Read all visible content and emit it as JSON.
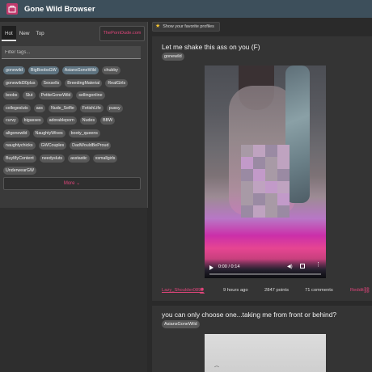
{
  "app": {
    "title": "Gone Wild Browser"
  },
  "sidebar": {
    "tabs": [
      "Hot",
      "New",
      "Top"
    ],
    "brand_link": "ThePornDude.com",
    "filter_placeholder": "Filter tags...",
    "tag_rows": [
      [
        {
          "label": "gonewild",
          "selected": true
        },
        {
          "label": "BigBoobsGW",
          "selected": true
        },
        {
          "label": "AsiansGoneWild",
          "selected": true
        },
        {
          "label": "chubby",
          "selected": false
        }
      ],
      [
        {
          "label": "gonewild30plus",
          "selected": false
        },
        {
          "label": "Sexsells",
          "selected": false
        },
        {
          "label": "BreedingMaterial",
          "selected": false
        },
        {
          "label": "RealGirls",
          "selected": false
        }
      ],
      [
        {
          "label": "boobs",
          "selected": false
        },
        {
          "label": "Slut",
          "selected": false
        },
        {
          "label": "PetiteGoneWild",
          "selected": false
        },
        {
          "label": "sellingonline",
          "selected": false
        }
      ],
      [
        {
          "label": "collegesluts",
          "selected": false
        },
        {
          "label": "ass",
          "selected": false
        },
        {
          "label": "Nude_Selfie",
          "selected": false
        },
        {
          "label": "FetishLife",
          "selected": false
        },
        {
          "label": "pussy",
          "selected": false
        }
      ],
      [
        {
          "label": "curvy",
          "selected": false
        },
        {
          "label": "bigasses",
          "selected": false
        },
        {
          "label": "adorableporn",
          "selected": false
        },
        {
          "label": "Nudes",
          "selected": false
        },
        {
          "label": "BBW",
          "selected": false
        }
      ],
      [
        {
          "label": "altgonewild",
          "selected": false
        },
        {
          "label": "NaughtyWives",
          "selected": false
        },
        {
          "label": "booty_queens",
          "selected": false
        }
      ],
      [
        {
          "label": "naughtychicks",
          "selected": false
        },
        {
          "label": "GWCouples",
          "selected": false
        },
        {
          "label": "DadWouldBeProud",
          "selected": false
        }
      ],
      [
        {
          "label": "BuyMyContent",
          "selected": false
        },
        {
          "label": "needysluts",
          "selected": false
        },
        {
          "label": "asstastic",
          "selected": false
        },
        {
          "label": "xsmallgirls",
          "selected": false
        }
      ],
      [
        {
          "label": "UnderwearGW",
          "selected": false
        }
      ]
    ],
    "more_label": "More"
  },
  "main": {
    "favorites_label": "Show your favorite profiles",
    "posts": [
      {
        "title": "Let me shake this ass on you (F)",
        "subreddit": "gonewild",
        "video": {
          "time": "0:00 / 0:14",
          "progress": 0
        },
        "author": "Lazy_Shoulder0892",
        "ago": "9 hours ago",
        "points": "2847 points",
        "comments": "71 comments",
        "source": "Reddit"
      },
      {
        "title": "you can only choose one...taking me from front or behind?",
        "subreddit": "AsiansGoneWild"
      }
    ]
  },
  "colors": {
    "accent": "#e0457b",
    "topbar": "#3d4f5b",
    "selected_tag": "#5e7380"
  },
  "icons": [
    "logo-icon",
    "star-icon",
    "chevron-down-icon",
    "play-icon",
    "mute-icon",
    "fullscreen-icon",
    "more-vert-icon",
    "user-icon",
    "link-icon"
  ]
}
